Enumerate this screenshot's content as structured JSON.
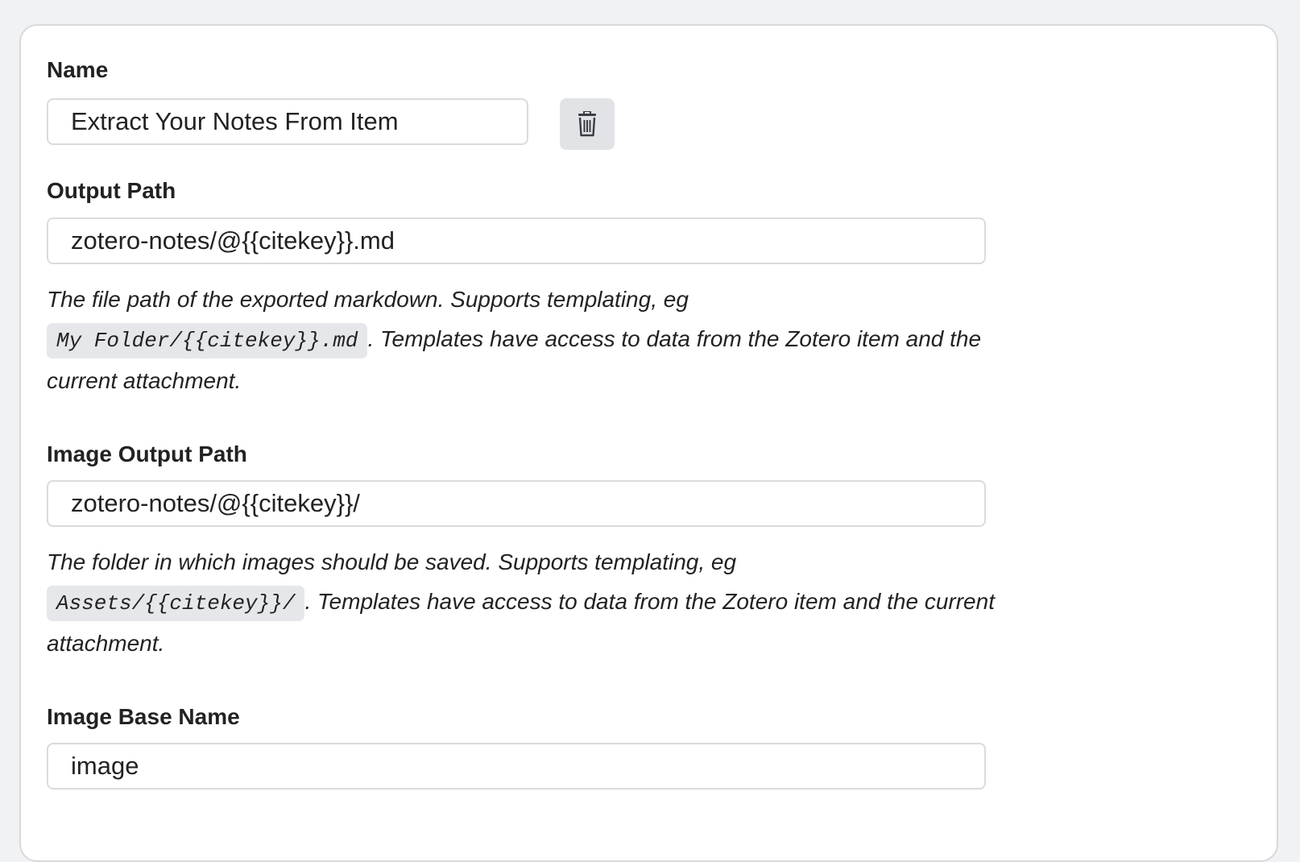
{
  "name": {
    "label": "Name",
    "value": "Extract Your Notes From Item",
    "delete_icon": "trash-icon"
  },
  "output_path": {
    "label": "Output Path",
    "value": "zotero-notes/@{{citekey}}.md",
    "help_before": "The file path of the exported markdown. Supports templating, eg",
    "help_code": "My Folder/{{citekey}}.md",
    "help_after": ". Templates have access to data from the Zotero item and the current attachment."
  },
  "image_output_path": {
    "label": "Image Output Path",
    "value": "zotero-notes/@{{citekey}}/",
    "help_before": "The folder in which images should be saved. Supports templating, eg",
    "help_code": "Assets/{{citekey}}/",
    "help_after": ". Templates have access to data from the Zotero item and the current attachment."
  },
  "image_base_name": {
    "label": "Image Base Name",
    "value": "image"
  }
}
